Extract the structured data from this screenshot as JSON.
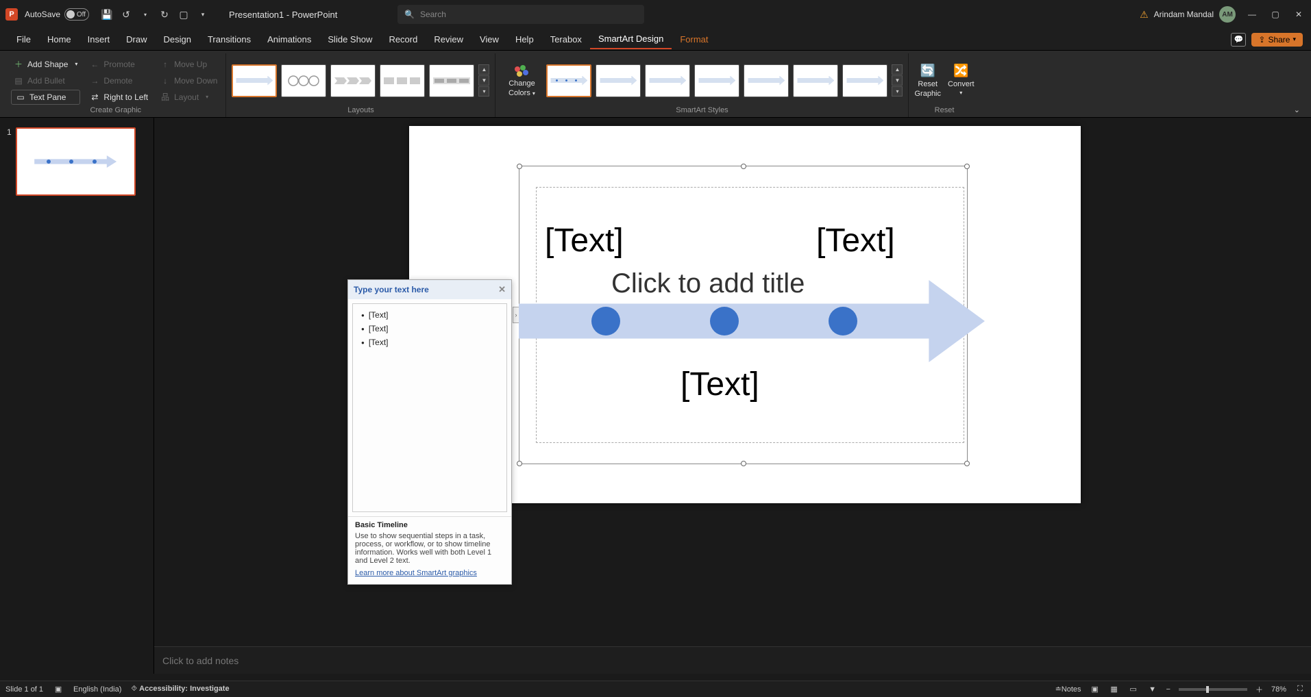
{
  "titlebar": {
    "autosave_label": "AutoSave",
    "autosave_state": "Off",
    "doc_title": "Presentation1 - PowerPoint",
    "search_placeholder": "Search",
    "user_name": "Arindam Mandal",
    "user_initials": "AM"
  },
  "tabs": {
    "items": [
      "File",
      "Home",
      "Insert",
      "Draw",
      "Design",
      "Transitions",
      "Animations",
      "Slide Show",
      "Record",
      "Review",
      "View",
      "Help",
      "Terabox",
      "SmartArt Design",
      "Format"
    ],
    "active": "SmartArt Design",
    "share_label": "Share"
  },
  "ribbon": {
    "create_graphic": {
      "add_shape": "Add Shape",
      "add_bullet": "Add Bullet",
      "text_pane": "Text Pane",
      "promote": "Promote",
      "demote": "Demote",
      "right_to_left": "Right to Left",
      "move_up": "Move Up",
      "move_down": "Move Down",
      "layout": "Layout",
      "group_label": "Create Graphic"
    },
    "layouts": {
      "group_label": "Layouts"
    },
    "change_colors": {
      "label_line1": "Change",
      "label_line2": "Colors"
    },
    "styles": {
      "group_label": "SmartArt Styles"
    },
    "reset": {
      "reset_graphic_line1": "Reset",
      "reset_graphic_line2": "Graphic",
      "convert": "Convert",
      "group_label": "Reset"
    }
  },
  "thumb": {
    "number": "1"
  },
  "text_pane": {
    "header": "Type your text here",
    "items": [
      "[Text]",
      "[Text]",
      "[Text]"
    ],
    "footer_title": "Basic Timeline",
    "footer_desc": "Use to show sequential steps in a task, process, or workflow, or to show timeline information. Works well with both Level 1 and Level 2 text.",
    "footer_link": "Learn more about SmartArt graphics"
  },
  "smartart": {
    "title_hint": "Click to add title",
    "label1": "[Text]",
    "label2": "[Text]",
    "label3": "[Text]"
  },
  "notes": {
    "placeholder": "Click to add notes"
  },
  "statusbar": {
    "slide": "Slide 1 of 1",
    "language": "English (India)",
    "accessibility": "Accessibility: Investigate",
    "notes_btn": "Notes",
    "zoom": "78%"
  }
}
